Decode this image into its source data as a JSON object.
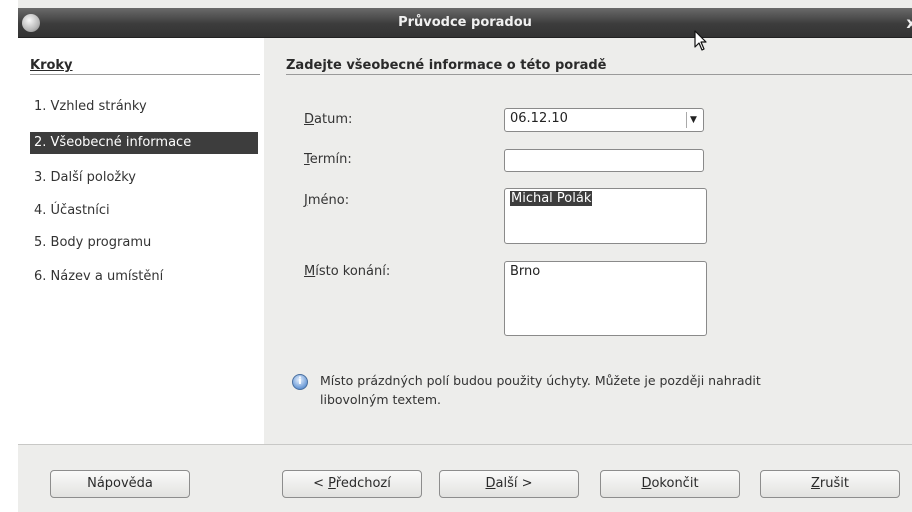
{
  "window": {
    "title": "Průvodce poradou",
    "close_glyph": "x"
  },
  "sidebar": {
    "heading": "Kroky",
    "steps": [
      {
        "label": "1. Vzhled stránky",
        "active": false
      },
      {
        "label": "2. Všeobecné informace",
        "active": true
      },
      {
        "label": "3. Další položky",
        "active": false
      },
      {
        "label": "4. Účastníci",
        "active": false
      },
      {
        "label": "5. Body programu",
        "active": false
      },
      {
        "label": "6. Název a umístění",
        "active": false
      }
    ]
  },
  "main": {
    "heading": "Zadejte všeobecné informace o této poradě",
    "fields": {
      "date_label_mnemonic": "D",
      "date_label_rest": "atum:",
      "date_value": "06.12.10",
      "time_label_mnemonic": "T",
      "time_label_rest": "ermín:",
      "time_value": "",
      "name_label_mnemonic": "J",
      "name_label_rest": "méno:",
      "name_value": "Michal Polák",
      "place_label_mnemonic": "M",
      "place_label_rest": "ísto konání:",
      "place_value": "Brno"
    },
    "hint_line1": "Místo prázdných polí budou použity úchyty. Můžete je později nahradit",
    "hint_line2": "libovolným textem."
  },
  "buttons": {
    "help": "Nápověda",
    "back_prefix": "< ",
    "back_mnemonic": "P",
    "back_rest": "ředchozí",
    "next_mnemonic": "D",
    "next_rest": "alší >",
    "finish_mnemonic": "D",
    "finish_rest": "okončit",
    "cancel_mnemonic": "Z",
    "cancel_rest": "rušit"
  },
  "colors": {
    "selected_bg": "#3d3d3d",
    "titlebar": "#3c3c3c",
    "dialog_bg": "#ededeb"
  },
  "icons": {
    "title": "app-icon",
    "hint": "lightbulb-info-icon",
    "combo": "dropdown-arrow-icon",
    "pointer": "mouse-cursor-icon"
  }
}
